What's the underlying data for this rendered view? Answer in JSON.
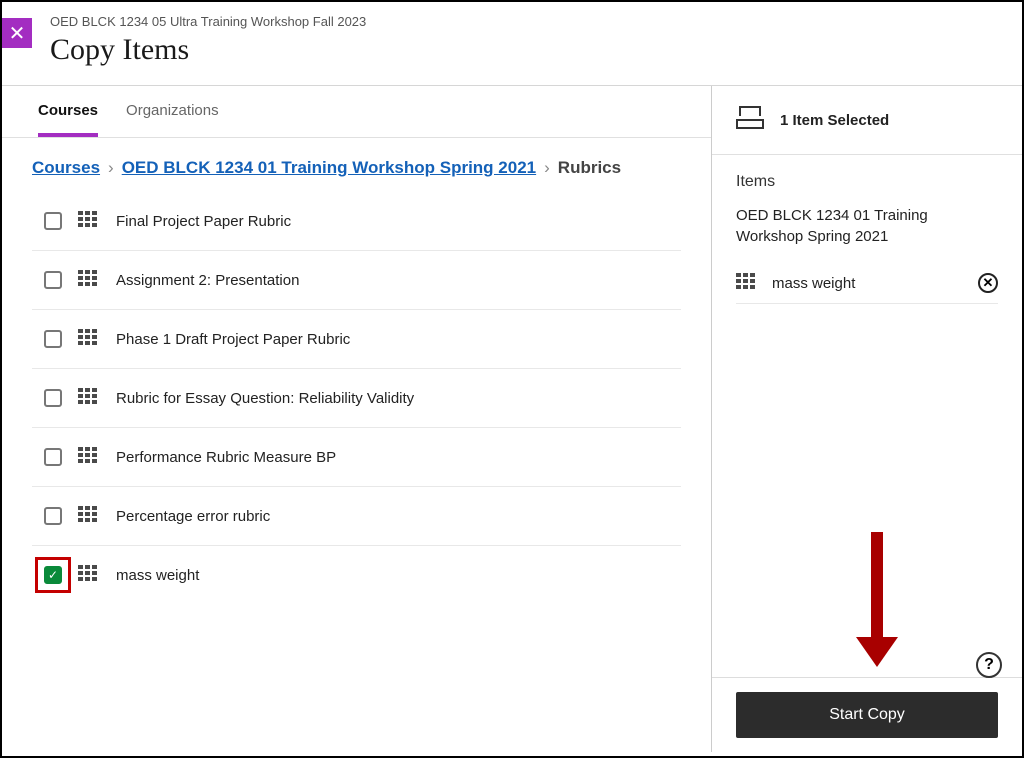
{
  "header": {
    "context": "OED BLCK 1234 05 Ultra Training Workshop Fall 2023",
    "title": "Copy Items"
  },
  "tabs": {
    "courses": "Courses",
    "organizations": "Organizations",
    "active": "courses"
  },
  "breadcrumb": {
    "root": "Courses",
    "course": "OED BLCK 1234 01 Training Workshop Spring 2021",
    "current": "Rubrics"
  },
  "rubrics": [
    {
      "label": "Final Project Paper Rubric",
      "checked": false,
      "highlight": false
    },
    {
      "label": "Assignment 2: Presentation",
      "checked": false,
      "highlight": false
    },
    {
      "label": "Phase 1 Draft Project Paper Rubric",
      "checked": false,
      "highlight": false
    },
    {
      "label": "Rubric for Essay Question: Reliability Validity",
      "checked": false,
      "highlight": false
    },
    {
      "label": "Performance Rubric Measure BP",
      "checked": false,
      "highlight": false
    },
    {
      "label": "Percentage error rubric",
      "checked": false,
      "highlight": false
    },
    {
      "label": "mass weight",
      "checked": true,
      "highlight": true
    }
  ],
  "sidebar": {
    "count_label": "1 Item Selected",
    "items_heading": "Items",
    "source_name": "OED BLCK 1234 01 Training Workshop Spring 2021",
    "selected": [
      {
        "label": "mass weight"
      }
    ]
  },
  "footer": {
    "start_label": "Start Copy"
  },
  "icons": {
    "close": "✕",
    "check": "✓",
    "remove": "✕",
    "help": "?"
  }
}
